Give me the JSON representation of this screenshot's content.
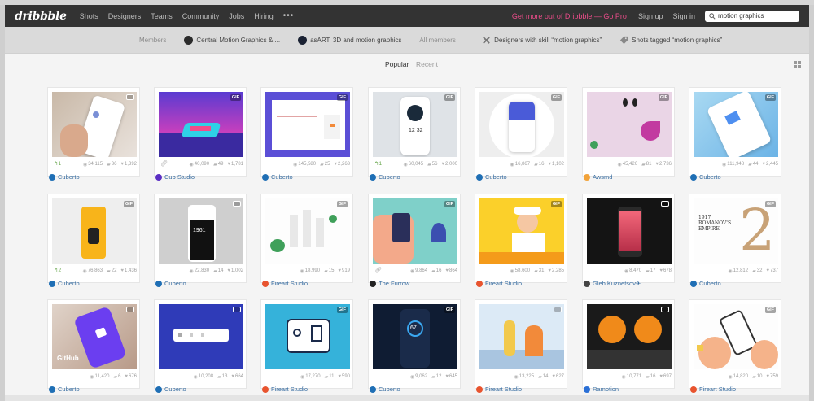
{
  "nav": {
    "logo": "dribbble",
    "items": [
      "Shots",
      "Designers",
      "Teams",
      "Community",
      "Jobs",
      "Hiring"
    ],
    "more": "•••",
    "pro_link": "Get more out of Dribbble — Go Pro",
    "signup": "Sign up",
    "signin": "Sign in",
    "search_value": "motion graphics"
  },
  "subbar": {
    "members_label": "Members",
    "group1": "Central Motion Graphics & ...",
    "group2": "asART. 3D and motion graphics",
    "all_members": "All members →",
    "designers_skill": "Designers with skill “motion graphics”",
    "shots_tagged": "Shots tagged “motion graphics”"
  },
  "tabs": {
    "popular": "Popular",
    "recent": "Recent"
  },
  "shots": [
    {
      "author": "Cuberto",
      "views": "34,115",
      "comments": "36",
      "likes": "1,392",
      "badge": "video",
      "rebound": "1",
      "attach": false,
      "av": "#1f6fb5"
    },
    {
      "author": "Cub Studio",
      "views": "40,090",
      "comments": "49",
      "likes": "1,781",
      "badge": "GIF",
      "rebound": "",
      "attach": true,
      "av": "#5b2fc4"
    },
    {
      "author": "Cuberto",
      "views": "145,580",
      "comments": "25",
      "likes": "2,263",
      "badge": "GIF",
      "rebound": "",
      "attach": false,
      "av": "#1f6fb5"
    },
    {
      "author": "Cuberto",
      "views": "60,045",
      "comments": "56",
      "likes": "2,000",
      "badge": "GIF",
      "rebound": "1",
      "attach": false,
      "av": "#1f6fb5"
    },
    {
      "author": "Cuberto",
      "views": "16,867",
      "comments": "16",
      "likes": "1,102",
      "badge": "GIF",
      "rebound": "",
      "attach": false,
      "av": "#1f6fb5"
    },
    {
      "author": "Awsmd",
      "views": "45,426",
      "comments": "81",
      "likes": "2,736",
      "badge": "GIF",
      "rebound": "",
      "attach": false,
      "av": "#f2a33a"
    },
    {
      "author": "Cuberto",
      "views": "111,948",
      "comments": "44",
      "likes": "2,445",
      "badge": "GIF",
      "rebound": "",
      "attach": false,
      "av": "#1f6fb5"
    },
    {
      "author": "Cuberto",
      "views": "76,863",
      "comments": "22",
      "likes": "1,436",
      "badge": "GIF",
      "rebound": "2",
      "attach": false,
      "av": "#1f6fb5"
    },
    {
      "author": "Cuberto",
      "views": "22,830",
      "comments": "14",
      "likes": "1,002",
      "badge": "video",
      "rebound": "",
      "attach": false,
      "av": "#1f6fb5"
    },
    {
      "author": "Fireart Studio",
      "views": "18,990",
      "comments": "15",
      "likes": "919",
      "badge": "GIF",
      "rebound": "",
      "attach": false,
      "av": "#e8542f"
    },
    {
      "author": "The Furrow",
      "views": "9,864",
      "comments": "16",
      "likes": "864",
      "badge": "GIF",
      "rebound": "",
      "attach": true,
      "av": "#222222"
    },
    {
      "author": "Fireart Studio",
      "views": "58,600",
      "comments": "31",
      "likes": "2,285",
      "badge": "GIF",
      "rebound": "",
      "attach": false,
      "av": "#e8542f"
    },
    {
      "author": "Gleb Kuznetsov✈",
      "views": "8,470",
      "comments": "17",
      "likes": "678",
      "badge": "video",
      "rebound": "",
      "attach": false,
      "av": "#444444"
    },
    {
      "author": "Cuberto",
      "views": "12,812",
      "comments": "32",
      "likes": "737",
      "badge": "GIF",
      "rebound": "",
      "attach": false,
      "av": "#1f6fb5"
    },
    {
      "author": "Cuberto",
      "views": "11,420",
      "comments": "6",
      "likes": "676",
      "badge": "video",
      "rebound": "",
      "attach": false,
      "av": "#1f6fb5"
    },
    {
      "author": "Cuberto",
      "views": "10,208",
      "comments": "13",
      "likes": "664",
      "badge": "video",
      "rebound": "",
      "attach": false,
      "av": "#1f6fb5"
    },
    {
      "author": "Fireart Studio",
      "views": "17,270",
      "comments": "11",
      "likes": "590",
      "badge": "GIF",
      "rebound": "",
      "attach": false,
      "av": "#e8542f"
    },
    {
      "author": "Cuberto",
      "views": "9,062",
      "comments": "12",
      "likes": "645",
      "badge": "GIF",
      "rebound": "",
      "attach": false,
      "av": "#1f6fb5"
    },
    {
      "author": "Fireart Studio",
      "views": "13,225",
      "comments": "14",
      "likes": "627",
      "badge": "video",
      "rebound": "",
      "attach": false,
      "av": "#e8542f"
    },
    {
      "author": "Ramotion",
      "views": "10,771",
      "comments": "16",
      "likes": "697",
      "badge": "video",
      "rebound": "",
      "attach": false,
      "av": "#2a6fd6"
    },
    {
      "author": "Fireart Studio",
      "views": "14,820",
      "comments": "10",
      "likes": "759",
      "badge": "GIF",
      "rebound": "",
      "attach": false,
      "av": "#e8542f"
    }
  ],
  "colors": {
    "accent": "#ea4c89",
    "link": "#3a6fa3",
    "nav_bg": "#333333"
  }
}
